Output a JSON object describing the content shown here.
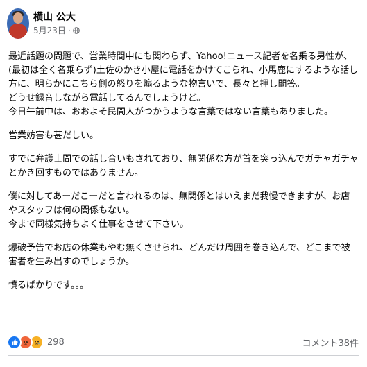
{
  "post": {
    "author": "横山 公大",
    "timestamp": "5月23日",
    "separator": "·",
    "privacy_icon": "globe-icon",
    "paragraphs": [
      [
        "最近話題の問題で、営業時間中にも関わらず、Yahoo!ニュース記者を名乗る男性が、(最初は全く名乗らず)土佐のかき小屋に電話をかけてこられ、小馬鹿にするような話し方に、明らかにこちら側の怒りを煽るような物言いで、長々と押し問答。",
        "どうせ録音しながら電話してるんでしょうけど。",
        "今日午前中は、おおよそ民間人がつかうような言葉ではない言葉もありました。"
      ],
      [
        "営業妨害も甚だしい。"
      ],
      [
        "すでに弁護士間での話し合いもされており、無関係な方が首を突っ込んでガチャガチャとかき回すものではありません。"
      ],
      [
        "僕に対してあーだこーだと言われるのは、無関係とはいえまだ我慢できますが、お店やスタッフは何の関係もない。",
        "今まで同様気持ちよく仕事をさせて下さい。"
      ],
      [
        "爆破予告でお店の休業もやむ無くさせられ、どんだけ周囲を巻き込んで、どこまで被害者を生み出すのでしょうか。"
      ],
      [
        "憤るばかりです。。。"
      ]
    ]
  },
  "footer": {
    "reaction_icons": [
      "like-icon",
      "angry-icon",
      "sad-icon"
    ],
    "reaction_count": "298",
    "comment_count": "コメント38件"
  },
  "colors": {
    "like": "#1877f2",
    "angry": "#f0653a",
    "sad": "#f7b125",
    "secondary_text": "#65676b"
  }
}
